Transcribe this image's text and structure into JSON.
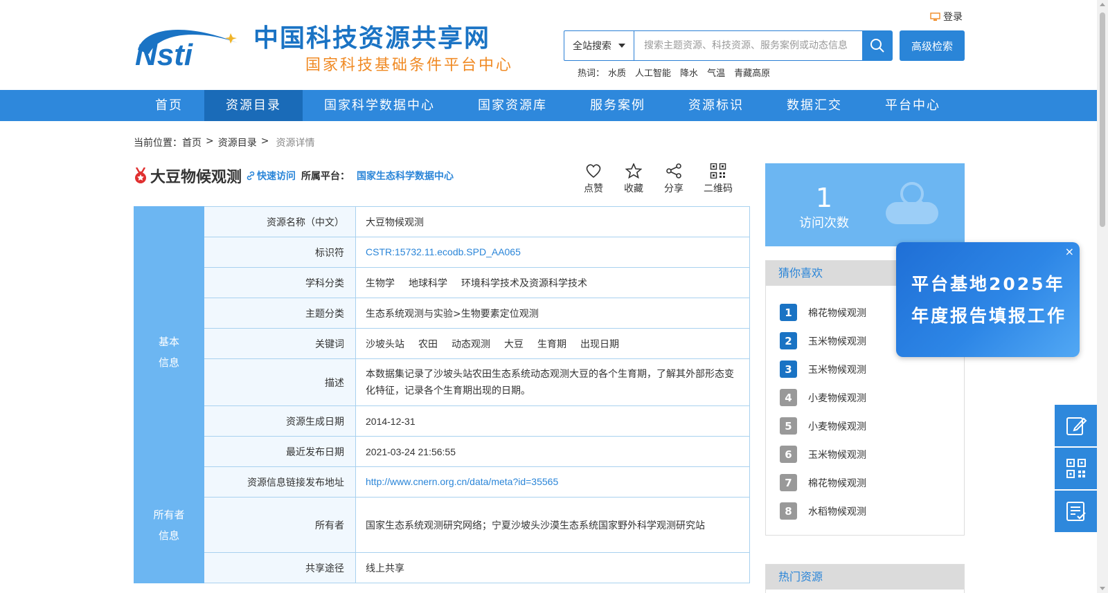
{
  "header": {
    "site_title": "中国科技资源共享网",
    "site_subtitle": "国家科技基础条件平台中心",
    "logo_text": "Nsti",
    "login": "登录",
    "search": {
      "scope": "全站搜索",
      "placeholder": "搜索主题资源、科技资源、服务案例或动态信息",
      "value": "",
      "advanced": "高级检索"
    },
    "hot_label": "热词：",
    "hot_words": [
      "水质",
      "人工智能",
      "降水",
      "气温",
      "青藏高原"
    ]
  },
  "nav": {
    "items": [
      "首页",
      "资源目录",
      "国家科学数据中心",
      "国家资源库",
      "服务案例",
      "资源标识",
      "数据汇交",
      "平台中心"
    ],
    "active_index": 1
  },
  "breadcrumb": {
    "label": "当前位置：",
    "items": [
      "首页",
      "资源目录"
    ],
    "separator": ">",
    "current": "资源详情"
  },
  "resource": {
    "title": "大豆物候观测",
    "quick_access": "快速访问",
    "platform_label": "所属平台：",
    "platform": "国家生态科学数据中心",
    "actions": [
      "点赞",
      "收藏",
      "分享",
      "二维码"
    ]
  },
  "info_table": {
    "groups": {
      "basic": [
        "基本",
        "信息"
      ],
      "owner": [
        "所有者",
        "信息"
      ]
    },
    "rows": {
      "name_cn": {
        "label": "资源名称（中文）",
        "value": "大豆物候观测"
      },
      "identifier": {
        "label": "标识符",
        "value": "CSTR:15732.11.ecodb.SPD_AA065"
      },
      "subject": {
        "label": "学科分类",
        "values": [
          "生物学",
          "地球科学",
          "环境科学技术及资源科学技术"
        ]
      },
      "topic": {
        "label": "主题分类",
        "value": "生态系统观测与实验>生物要素定位观测"
      },
      "keywords": {
        "label": "关键词",
        "values": [
          "沙坡头站",
          "农田",
          "动态观测",
          "大豆",
          "生育期",
          "出现日期"
        ]
      },
      "description": {
        "label": "描述",
        "value": "本数据集记录了沙坡头站农田生态系统动态观测大豆的各个生育期，了解其外部形态变化特征，记录各个生育期出现的日期。"
      },
      "create_date": {
        "label": "资源生成日期",
        "value": "2014-12-31"
      },
      "publish_date": {
        "label": "最近发布日期",
        "value": "2021-03-24 21:56:55"
      },
      "link": {
        "label": "资源信息链接发布地址",
        "value": "http://www.cnern.org.cn/data/meta?id=35565"
      },
      "owner": {
        "label": "所有者",
        "value": "国家生态系统观测研究网络；宁夏沙坡头沙漠生态系统国家野外科学观测研究站"
      },
      "share": {
        "label": "共享途径",
        "value": "线上共享"
      }
    }
  },
  "sidebar": {
    "visits": {
      "count": "1",
      "label": "访问次数"
    },
    "guess": {
      "title": "猜你喜欢",
      "items": [
        "棉花物候观测",
        "玉米物候观测",
        "玉米物候观测",
        "小麦物候观测",
        "小麦物候观测",
        "玉米物候观测",
        "棉花物候观测",
        "水稻物候观测"
      ],
      "ranks": [
        "1",
        "2",
        "3",
        "4",
        "5",
        "6",
        "7",
        "8"
      ]
    },
    "hot": {
      "title": "热门资源"
    }
  },
  "popup": {
    "text": "平台基地2025年年度报告填报工作",
    "close": "×"
  },
  "colors": {
    "primary": "#2e88dc",
    "nav_active": "#1a6bb8",
    "light_blue": "#6cb6f2",
    "label_bg": "#f1f8fe",
    "link": "#2a85d8",
    "orange": "#f08a24",
    "rank_top": "#1a73c4",
    "rank_other": "#999999"
  }
}
